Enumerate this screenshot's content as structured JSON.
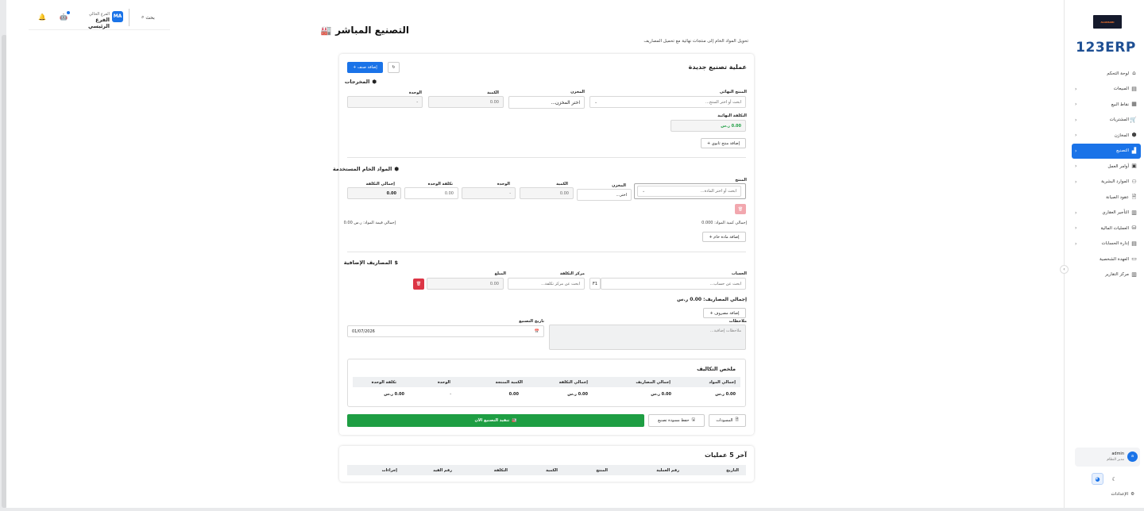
{
  "topbar": {
    "search_label": "بحث",
    "avatar_initials": "MA",
    "branch_label": "الفرع الحالي",
    "branch_value": "الفرع الرئيسي"
  },
  "sidebar": {
    "logo_small": "ALANSARI",
    "logo_text": "123ERP",
    "items": [
      {
        "label": "لوحة التحكم",
        "icon": "home-icon",
        "has_children": false,
        "active": false
      },
      {
        "label": "المبيعات",
        "icon": "invoice-icon",
        "has_children": true,
        "active": false
      },
      {
        "label": "نقاط البيع",
        "icon": "pos-icon",
        "has_children": true,
        "active": false
      },
      {
        "label": "المشتريات",
        "icon": "cart-icon",
        "has_children": true,
        "active": false
      },
      {
        "label": "المخازن",
        "icon": "box-icon",
        "has_children": true,
        "active": false
      },
      {
        "label": "التصنيع",
        "icon": "factory-icon",
        "has_children": true,
        "active": true
      },
      {
        "label": "أوامر العمل",
        "icon": "briefcase-icon",
        "has_children": true,
        "active": false
      },
      {
        "label": "الموارد البشرية",
        "icon": "people-icon",
        "has_children": true,
        "active": false
      },
      {
        "label": "عقود الصيانة",
        "icon": "document-icon",
        "has_children": false,
        "active": false
      },
      {
        "label": "التأجير العقاري",
        "icon": "building-icon",
        "has_children": true,
        "active": false
      },
      {
        "label": "العمليات المالية",
        "icon": "coins-icon",
        "has_children": true,
        "active": false
      },
      {
        "label": "إدارة الحسابات",
        "icon": "ledger-icon",
        "has_children": true,
        "active": false
      },
      {
        "label": "العهدة الشخصية",
        "icon": "wallet-icon",
        "has_children": false,
        "active": false
      },
      {
        "label": "مركز التقارير",
        "icon": "report-icon",
        "has_children": false,
        "active": false
      }
    ],
    "user_initial": "a",
    "user_name": "admin",
    "user_role": "مدير النظام",
    "settings_label": "الإعدادات"
  },
  "page": {
    "title": "التصنيع المباشر",
    "subtitle": "تحويل المواد الخام إلى منتجات نهائية مع تحميل المصاريف"
  },
  "new_op": {
    "title": "عملية تصنيع جديدة",
    "add_item_label": "إضافة صنف +",
    "outputs": {
      "title": "المخرجات",
      "product_label": "المنتج النهائي",
      "product_placeholder": "ابحث أو اختر المنتج...",
      "warehouse_label": "المخزن",
      "warehouse_placeholder": "اختر المخزن...",
      "qty_label": "الكمية",
      "qty_value": "0.00",
      "unit_label": "الوحدة",
      "unit_value": "-",
      "final_cost_label": "التكلفة النهائية",
      "final_cost_value": "0.00 ر.س",
      "add_byproduct_label": "إضافة منتج ثانوي +"
    },
    "raw": {
      "title": "المواد الخام المستخدمة",
      "product_label": "المنتج",
      "product_placeholder": "ابحث أو اختر المادة...",
      "warehouse_label": "المخزن",
      "warehouse_value": "اختر...",
      "qty_label": "الكمية",
      "qty_value": "0.00",
      "unit_label": "الوحدة",
      "unit_value": "-",
      "unit_cost_label": "تكلفة الوحدة",
      "unit_cost_value": "0.00",
      "total_cost_label": "إجمالي التكلفة",
      "total_cost_value": "0.00",
      "total_qty_text": "إجمالي كمية المواد: 0.000",
      "total_value_text": "إجمالي قيمة المواد: ر.س 0.00",
      "add_raw_label": "إضافة مادة خام +"
    },
    "expenses": {
      "title": "المصاريف الإضافية",
      "account_label": "الحساب",
      "account_placeholder": "ابحث عن حساب...",
      "account_key": "F1",
      "cost_center_label": "مركز التكلفة",
      "cost_center_placeholder": "ابحث عن مركز تكلفة...",
      "amount_label": "المبلغ",
      "amount_value": "0.00",
      "total_text": "إجمالي المصاريف: 0.00 ر.س",
      "add_expense_label": "إضافة مصروف +"
    },
    "notes_label": "ملاحظات",
    "notes_placeholder": "ملاحظات إضافية...",
    "date_label": "تاريخ التصنيع",
    "date_value": "01/07/2026",
    "summary": {
      "title": "ملخص التكاليف",
      "headers": [
        "إجمالي المواد",
        "إجمالي المصاريف",
        "إجمالي التكلفة",
        "الكمية المنتجة",
        "الوحدة",
        "تكلفة الوحدة"
      ],
      "values": [
        "0.00 ر.س",
        "0.00 ر.س",
        "0.00 ر.س",
        "0.00",
        "-",
        "0.00 ر.س"
      ]
    },
    "drafts_label": "المسودات",
    "save_draft_label": "حفظ مسودة تصنيع",
    "execute_label": "تنفيذ التصنيع الآن"
  },
  "last_ops": {
    "title": "آخر 5 عمليات",
    "headers": [
      "التاريخ",
      "رقم العملية",
      "المنتج",
      "الكمية",
      "التكلفة",
      "رقم القيد",
      "إجراءات"
    ]
  },
  "colors": {
    "primary": "#1a73e8",
    "success": "#1e9e43",
    "danger": "#dc3545"
  }
}
